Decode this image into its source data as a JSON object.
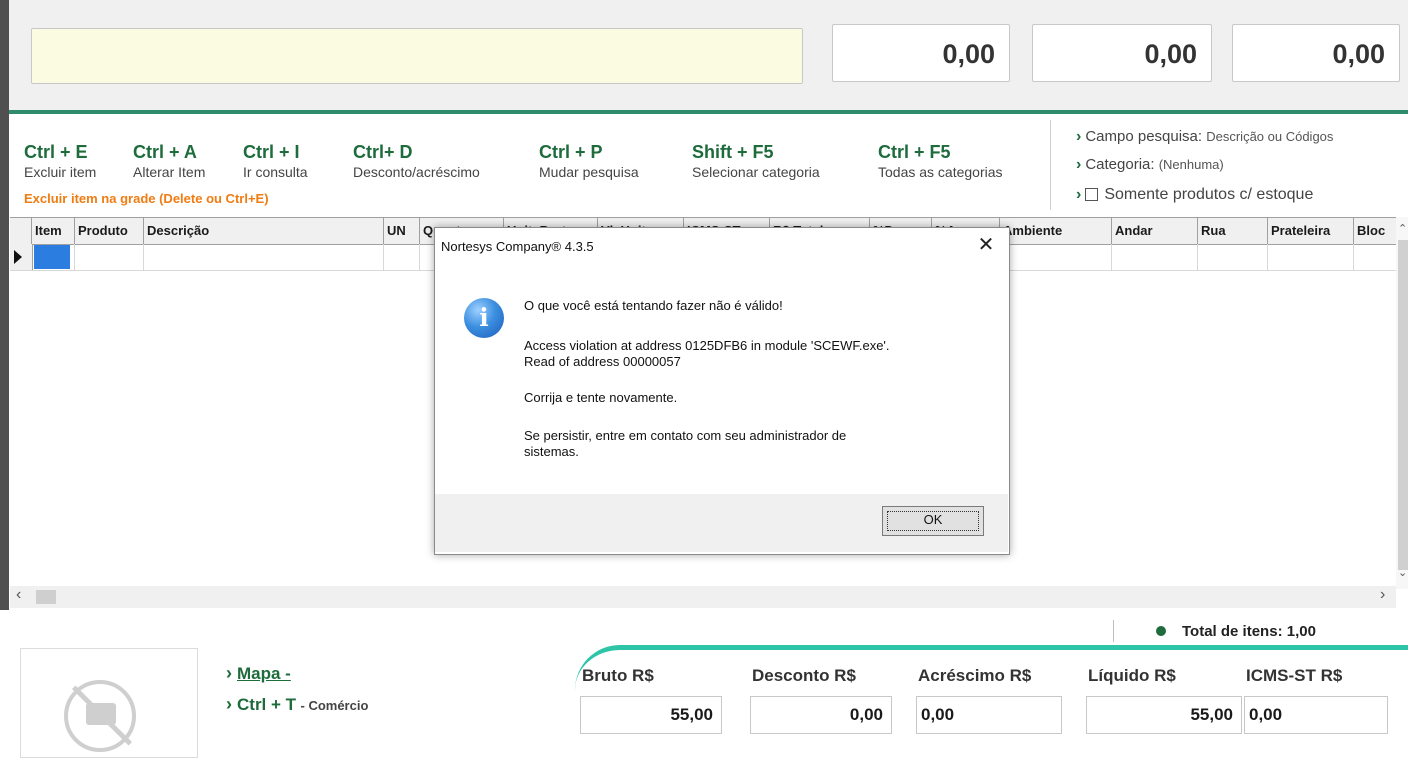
{
  "totals_top": [
    "0,00",
    "0,00",
    "0,00"
  ],
  "shortcuts": [
    {
      "key": "Ctrl + E",
      "desc": "Excluir item"
    },
    {
      "key": "Ctrl + A",
      "desc": "Alterar Item"
    },
    {
      "key": "Ctrl + I",
      "desc": "Ir consulta"
    },
    {
      "key": "Ctrl+ D",
      "desc": "Desconto/acréscimo"
    },
    {
      "key": "Ctrl + P",
      "desc": "Mudar pesquisa"
    },
    {
      "key": "Shift + F5",
      "desc": "Selecionar categoria"
    },
    {
      "key": "Ctrl + F5",
      "desc": "Todas as categorias"
    }
  ],
  "grade_hint": "Excluir item na grade (Delete ou Ctrl+E)",
  "options": {
    "campo_label": "Campo pesquisa:",
    "campo_value": "Descrição ou Códigos",
    "categoria_label": "Categoria:",
    "categoria_value": "(Nenhuma)",
    "estoque_label": "Somente produtos c/ estoque"
  },
  "grid_columns": [
    "Item",
    "Produto",
    "Descrição",
    "UN",
    "Quant",
    "Unit. Bruto",
    "Vl. Unit",
    "ICMS-ST",
    "R$ Total",
    "%Desc",
    "%Acr",
    "Ambiente",
    "Andar",
    "Rua",
    "Prateleira",
    "Bloc"
  ],
  "footer": {
    "total_items": "Total de itens: 1,00",
    "mapa_label": "Mapa -",
    "ctrl_t_label": "Ctrl + T",
    "ctrl_t_sub": "- Comércio",
    "fields": [
      {
        "label": "Bruto R$",
        "value": "55,00"
      },
      {
        "label": "Desconto R$",
        "value": "0,00"
      },
      {
        "label": "Acréscimo R$",
        "value": "0,00"
      },
      {
        "label": "Líquido R$",
        "value": "55,00"
      },
      {
        "label": "ICMS-ST R$",
        "value": "0,00"
      }
    ]
  },
  "dialog": {
    "title": "Nortesys Company® 4.3.5",
    "line1": "O que você está tentando fazer não é válido!",
    "line2": "Access violation at address 0125DFB6 in module 'SCEWF.exe'.",
    "line3": "Read of address 00000057",
    "line4": "Corrija e tente novamente.",
    "line5": "Se persistir, entre em contato com seu administrador de",
    "line6": "sistemas.",
    "ok_label": "OK",
    "icon": "information-icon"
  }
}
